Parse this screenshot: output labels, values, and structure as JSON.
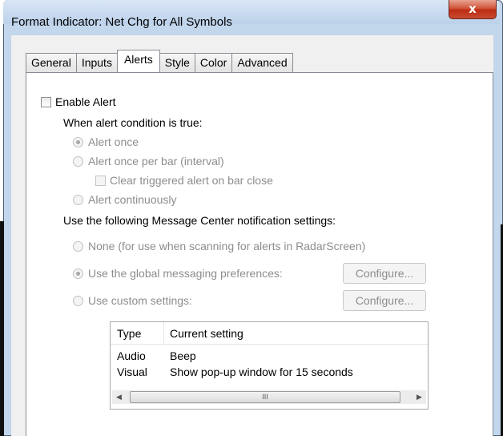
{
  "window": {
    "title": "Format Indicator: Net Chg for All Symbols",
    "close_glyph": "x"
  },
  "tabs": [
    {
      "label": "General",
      "active": false
    },
    {
      "label": "Inputs",
      "active": false
    },
    {
      "label": "Alerts",
      "active": true
    },
    {
      "label": "Style",
      "active": false
    },
    {
      "label": "Color",
      "active": false
    },
    {
      "label": "Advanced",
      "active": false
    }
  ],
  "alerts": {
    "enable_label": "Enable Alert",
    "enable_checked": false,
    "condition_heading": "When alert condition is true:",
    "frequency_options": [
      {
        "label": "Alert once",
        "selected": true
      },
      {
        "label": "Alert once per bar (interval)",
        "selected": false
      },
      {
        "label": "Alert continuously",
        "selected": false
      }
    ],
    "clear_on_close_label": "Clear triggered alert on bar close",
    "clear_on_close_checked": false,
    "message_heading": "Use the following Message Center notification settings:",
    "notification_options": [
      {
        "label": "None (for use when scanning for alerts in RadarScreen)",
        "selected": false
      },
      {
        "label": "Use the global messaging preferences:",
        "selected": true
      },
      {
        "label": "Use custom settings:",
        "selected": false
      }
    ],
    "configure_label": "Configure...",
    "settings_table": {
      "columns": [
        "Type",
        "Current setting"
      ],
      "rows": [
        [
          "Audio",
          "Beep"
        ],
        [
          "Visual",
          "Show pop-up window for 15 seconds"
        ]
      ]
    },
    "scroll_left_glyph": "◀",
    "scroll_right_glyph": "▶",
    "scroll_thumb_grip": "III"
  }
}
